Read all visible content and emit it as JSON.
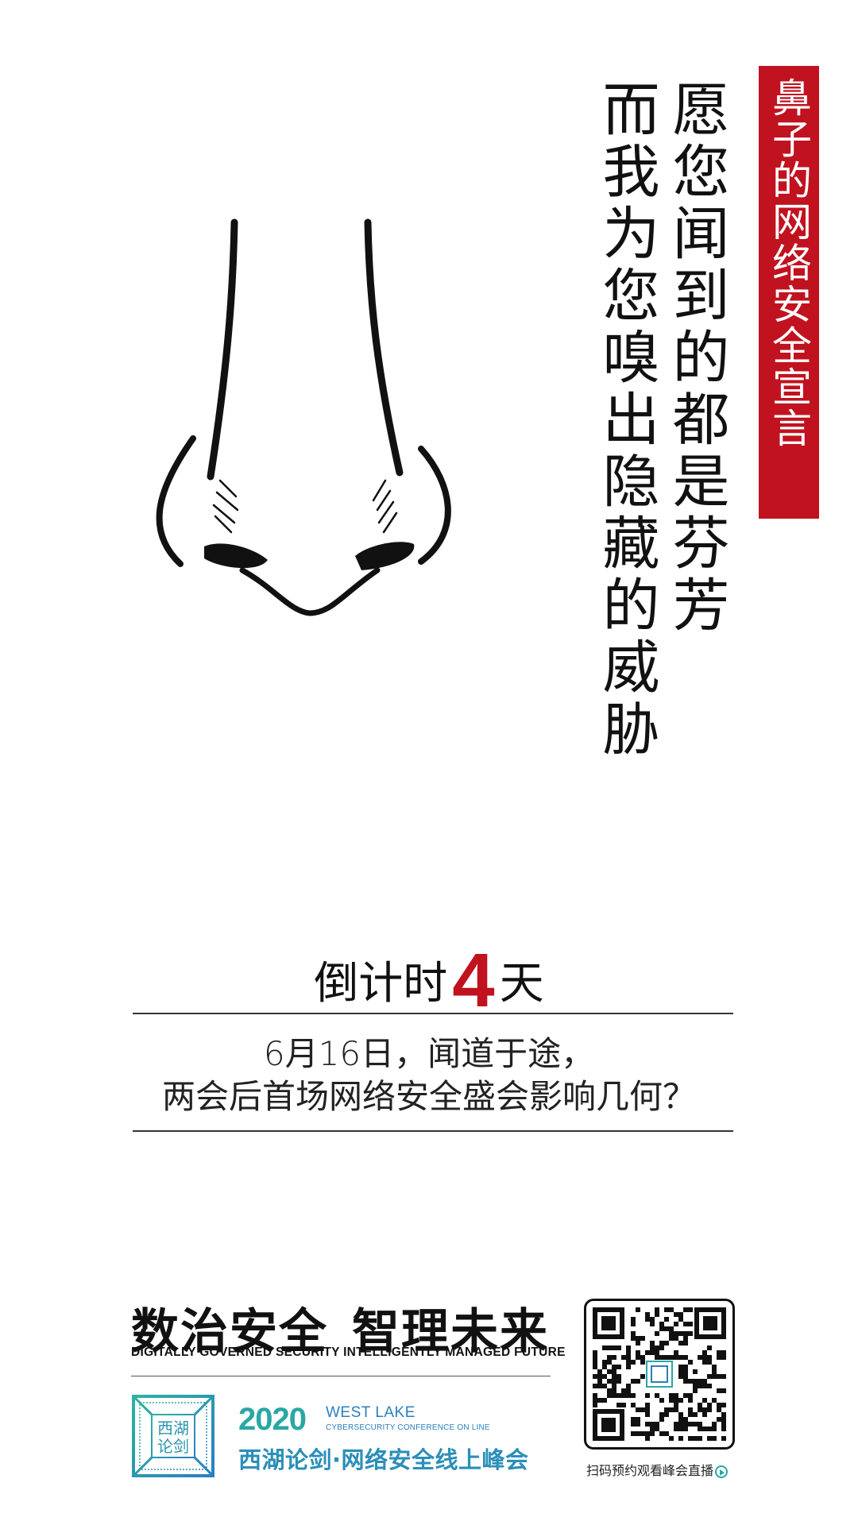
{
  "badge": {
    "text": "鼻子的网络安全宣言"
  },
  "slogan": {
    "line1": "愿您闻到的都是芬芳",
    "line2": "而我为您嗅出隐藏的威胁"
  },
  "countdown": {
    "prefix": "倒计时",
    "number": "4",
    "suffix": "天"
  },
  "subtitle": {
    "line1": "6月16日，闻道于途，",
    "line2": "两会后首场网络安全盛会影响几何？"
  },
  "footer": {
    "slogan_left": "数治安全",
    "slogan_right": "智理未来",
    "slogan_en": "DIGITALLY GOVERNED SECURITY  INTELLIGENTLY MANAGED FUTURE",
    "logo_text_top": "西湖",
    "logo_text_bottom": "论剑",
    "year": "2020",
    "west_lake": "WEST LAKE",
    "conference_en": "CYBERSECURITY CONFERENCE ON LINE",
    "conference_cn": "西湖论剑·网络安全线上峰会",
    "qr_caption": "扫码预约观看峰会直播"
  },
  "colors": {
    "accent_red": "#c1121f",
    "teal": "#2aa7a5",
    "blue": "#2a7fc1"
  }
}
